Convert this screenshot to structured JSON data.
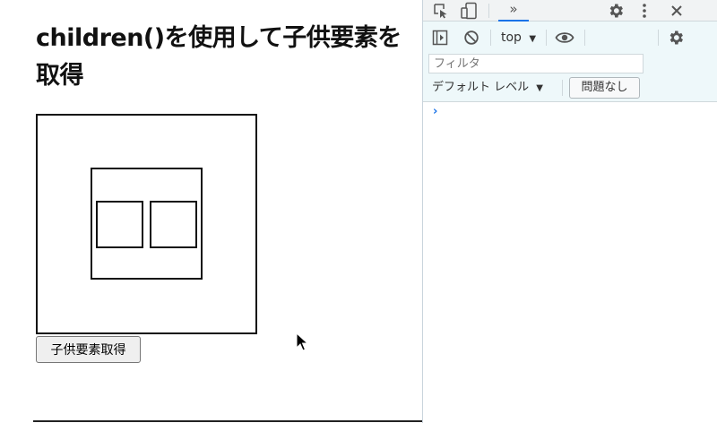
{
  "page": {
    "title": "children()を使用して子供要素を取得",
    "button_label": "子供要素取得"
  },
  "devtools": {
    "more_tabs": "»",
    "context": "top",
    "filter_placeholder": "フィルタ",
    "log_level": "デフォルト レベル",
    "issues_label": "問題なし",
    "prompt_symbol": "›",
    "accent_color": "#1a73e8",
    "icons": [
      "inspect-element-icon",
      "device-toolbar-icon",
      "gear-icon",
      "kebab-menu-icon",
      "close-icon",
      "sidebar-toggle-icon",
      "clear-console-icon",
      "eye-icon"
    ]
  }
}
